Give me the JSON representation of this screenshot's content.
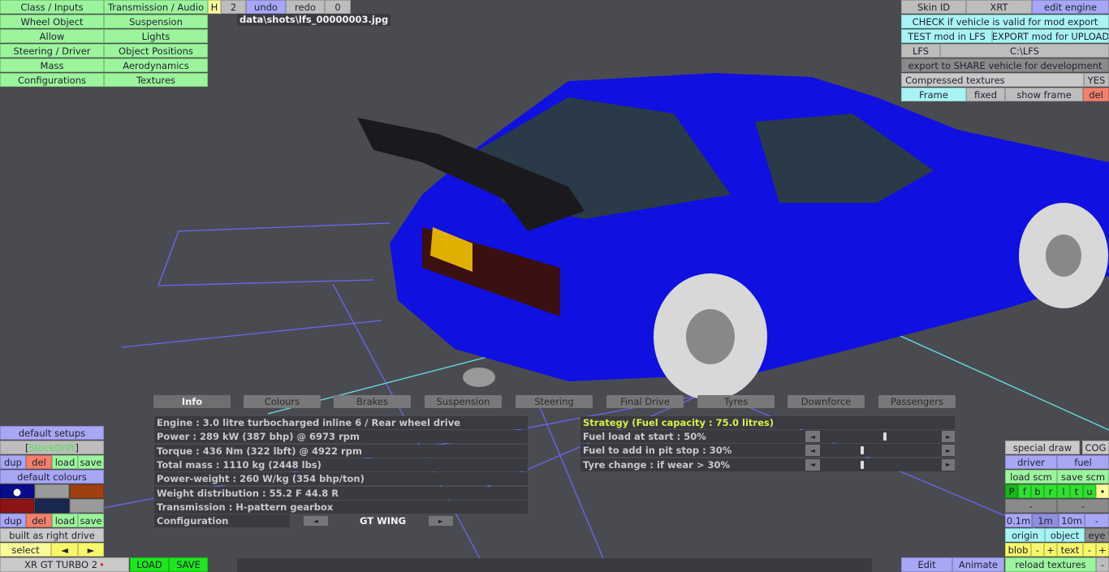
{
  "top_left_menu": [
    [
      "Class / Inputs",
      "Transmission / Audio"
    ],
    [
      "Wheel Object",
      "Suspension"
    ],
    [
      "Allow",
      "Lights"
    ],
    [
      "Steering / Driver",
      "Object Positions"
    ],
    [
      "Mass",
      "Aerodynamics"
    ],
    [
      "Configurations",
      "Textures"
    ]
  ],
  "toolbar": {
    "h": "H",
    "num": "2",
    "undo": "undo",
    "redo": "redo",
    "zero": "0"
  },
  "screenshot_path": "data\\shots\\lfs_00000003.jpg",
  "top_right": {
    "skin_id": "Skin ID",
    "xrt": "XRT",
    "edit_engine": "edit engine",
    "check": "CHECK if vehicle is valid for mod export",
    "test": "TEST mod in LFS",
    "export": "EXPORT mod for UPLOAD",
    "lfs": "LFS",
    "path": "C:\\LFS",
    "share": "export to SHARE vehicle for development",
    "compressed": "Compressed textures",
    "yes": "YES",
    "frame": "Frame",
    "fixed": "fixed",
    "show_frame": "show frame",
    "del": "del"
  },
  "tabs": [
    "Info",
    "Colours",
    "Brakes",
    "Suspension",
    "Steering",
    "Final Drive",
    "Tyres",
    "Downforce",
    "Passengers"
  ],
  "info": {
    "rows": [
      "Engine : 3.0 litre turbocharged inline 6 / Rear wheel drive",
      "Power : 289 kW (387 bhp) @ 6973 rpm",
      "Torque : 436 Nm (322 lbft) @ 4922 rpm",
      "Total mass : 1110 kg (2448 lbs)",
      "Power-weight : 260 W/kg (354 bhp/ton)",
      "Weight distribution : 55.2 F  44.8 R",
      "Transmission : H-pattern gearbox"
    ],
    "config_label": "Configuration",
    "config_value": "GT WING",
    "prev": "◄",
    "next": "►"
  },
  "strategy": {
    "title": "Strategy (Fuel capacity : 75.0 litres)",
    "sliders": [
      {
        "label": "Fuel load at start : 50%",
        "value": 0.5
      },
      {
        "label": "Fuel to add in pit stop : 30%",
        "value": 0.3
      },
      {
        "label": "Tyre change : if wear > 30%",
        "value": 0.3
      }
    ]
  },
  "left_bottom": {
    "default_setups": "default setups",
    "setup_name": "StockDrift",
    "dup": "dup",
    "del": "del",
    "load": "load",
    "save": "save",
    "default_colours": "default colours",
    "colours": [
      "#0a0a8c",
      "#9a9a9a",
      "#a04010",
      "#8c1414",
      "#1a2850",
      "#9a9a9a"
    ],
    "right_drive": "built as right drive",
    "select": "select",
    "left": "◄",
    "right": "►",
    "car_name": "XR GT TURBO 2",
    "LOAD": "LOAD",
    "SAVE": "SAVE"
  },
  "right_bottom": {
    "special_draw": "special draw",
    "cog": "COG",
    "driver": "driver",
    "fuel": "fuel",
    "load_scm": "load scm",
    "save_scm": "save scm",
    "flags": [
      "P",
      "f",
      "b",
      "r",
      "l",
      "t",
      "u",
      "•"
    ],
    "dash": "-",
    "m01": "0.1m",
    "m1": "1m",
    "m10": "10m",
    "origin": "origin",
    "object": "object",
    "eye": "eye",
    "blob": "blob",
    "minus": "-",
    "plus": "+",
    "text": "text",
    "reload": "reload textures",
    "edit": "Edit",
    "animate": "Animate"
  }
}
